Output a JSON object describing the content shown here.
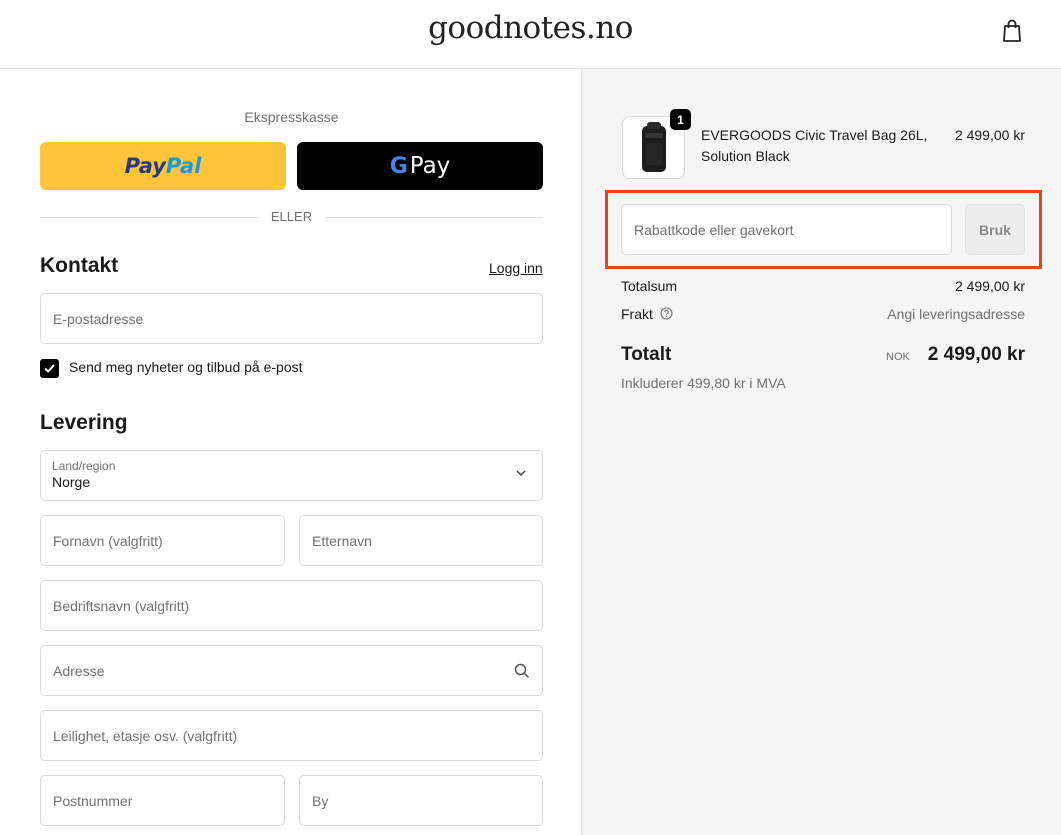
{
  "header": {
    "brand": "goodnotes.no",
    "cart_icon": "shopping-bag-icon"
  },
  "express": {
    "label": "Ekspresskasse",
    "paypal_part1": "Pay",
    "paypal_part2": "Pal",
    "gpay_g": "G",
    "gpay_text": "Pay",
    "divider": "ELLER"
  },
  "contact": {
    "heading": "Kontakt",
    "login_link": "Logg inn",
    "email_placeholder": "E-postadresse",
    "newsletter_label": "Send meg nyheter og tilbud på e-post",
    "newsletter_checked": true
  },
  "delivery": {
    "heading": "Levering",
    "country_label": "Land/region",
    "country_value": "Norge",
    "first_name": "Fornavn (valgfritt)",
    "last_name": "Etternavn",
    "company": "Bedriftsnavn (valgfritt)",
    "address": "Adresse",
    "apartment": "Leilighet, etasje osv. (valgfritt)",
    "postcode": "Postnummer",
    "city": "By"
  },
  "summary": {
    "product_name": "EVERGOODS Civic Travel Bag 26L, Solution Black",
    "product_price": "2 499,00 kr",
    "quantity": "1",
    "discount_placeholder": "Rabattkode eller gavekort",
    "apply_label": "Bruk",
    "subtotal_label": "Totalsum",
    "subtotal_value": "2 499,00 kr",
    "shipping_label": "Frakt",
    "shipping_value": "Angi leveringsadresse",
    "total_label": "Totalt",
    "currency": "NOK",
    "total_value": "2 499,00 kr",
    "vat_note": "Inkluderer 499,80 kr i MVA"
  },
  "colors": {
    "accent_highlight": "#e8431c",
    "paypal_yellow": "#ffc439"
  }
}
